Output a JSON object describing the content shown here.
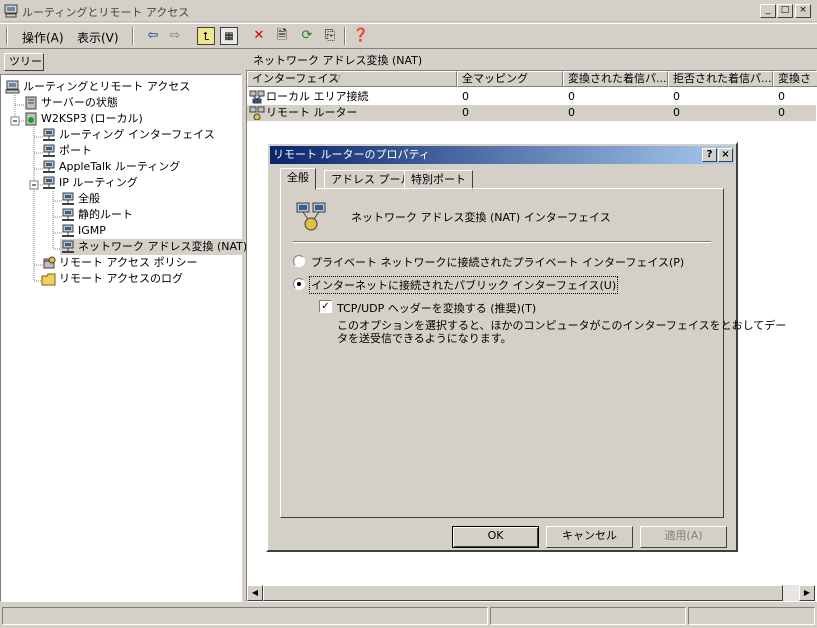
{
  "window": {
    "title": "ルーティングとリモート アクセス",
    "min_label": "_",
    "max_label": "□",
    "close_label": "×"
  },
  "menu": {
    "action": "操作(A)",
    "view": "表示(V)"
  },
  "toolbar_icons": [
    "back-icon",
    "forward-icon",
    "up-icon",
    "show-tree-icon",
    "delete-icon",
    "properties-icon",
    "refresh-icon",
    "export-icon",
    "help-icon"
  ],
  "tree": {
    "tab_label": "ツリー",
    "items": [
      {
        "label": "ルーティングとリモート アクセス",
        "icon": "computer-icon",
        "level": 0
      },
      {
        "label": "サーバーの状態",
        "icon": "server-icon",
        "level": 1
      },
      {
        "label": "W2KSP3 (ローカル)",
        "icon": "server-up-icon",
        "level": 1
      },
      {
        "label": "ルーティング インターフェイス",
        "icon": "network-icon",
        "level": 2
      },
      {
        "label": "ポート",
        "icon": "network-icon",
        "level": 2
      },
      {
        "label": "AppleTalk ルーティング",
        "icon": "network-icon",
        "level": 2
      },
      {
        "label": "IP ルーティング",
        "icon": "network-icon",
        "level": 2
      },
      {
        "label": "全般",
        "icon": "network-icon",
        "level": 3
      },
      {
        "label": "静的ルート",
        "icon": "network-icon",
        "level": 3
      },
      {
        "label": "IGMP",
        "icon": "network-icon",
        "level": 3
      },
      {
        "label": "ネットワーク アドレス変換 (NAT)",
        "icon": "network-icon",
        "level": 3
      },
      {
        "label": "リモート アクセス ポリシー",
        "icon": "policy-icon",
        "level": 2
      },
      {
        "label": "リモート アクセスのログ",
        "icon": "folder-icon",
        "level": 2
      }
    ]
  },
  "list": {
    "title": "ネットワーク アドレス変換 (NAT)",
    "columns": [
      "インターフェイス",
      "全マッピング",
      "変換された着信パ...",
      "拒否された着信パ...",
      "変換さ"
    ],
    "rows": [
      {
        "name": "ローカル エリア接続",
        "values": [
          "0",
          "0",
          "0",
          "0"
        ]
      },
      {
        "name": "リモート ルーター",
        "values": [
          "0",
          "0",
          "0",
          "0"
        ]
      }
    ]
  },
  "dialog": {
    "title": "リモート ルーターのプロパティ",
    "help_label": "?",
    "close_label": "×",
    "tabs": [
      "全般",
      "アドレス プール",
      "特別ポート"
    ],
    "heading": "ネットワーク アドレス変換 (NAT) インターフェイス",
    "radio_private": "プライベート ネットワークに接続されたプライベート インターフェイス(P)",
    "radio_public": "インターネットに接続されたパブリック インターフェイス(U)",
    "checkbox_label": "TCP/UDP ヘッダーを変換する (推奨)(T)",
    "checkbox_mark": "✓",
    "description_line1": "このオプションを選択すると、ほかのコンピュータがこのインターフェイスをとおしてデー",
    "description_line2": "タを送受信できるようになります。",
    "ok": "OK",
    "cancel": "キャンセル",
    "apply": "適用(A)"
  }
}
